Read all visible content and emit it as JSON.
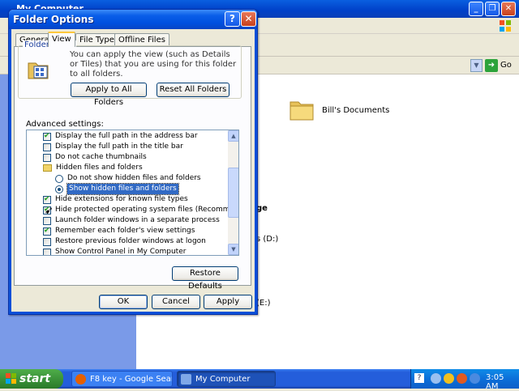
{
  "background_window": {
    "title": "My Computer",
    "address_go_label": "Go",
    "items": [
      {
        "label": "Bill's Documents"
      }
    ],
    "fragments": [
      "ge",
      "s (D:)",
      "(E:)"
    ]
  },
  "dialog": {
    "title": "Folder Options",
    "help_glyph": "?",
    "close_glyph": "✕",
    "tabs": [
      {
        "label": "General"
      },
      {
        "label": "View"
      },
      {
        "label": "File Types"
      },
      {
        "label": "Offline Files"
      }
    ],
    "active_tab": "View",
    "folder_views": {
      "legend": "Folder views",
      "description": "You can apply the view (such as Details or Tiles) that you are using for this folder to all folders.",
      "apply_button": "Apply to All Folders",
      "reset_button": "Reset All Folders"
    },
    "advanced": {
      "label": "Advanced settings:",
      "items": [
        {
          "type": "checkbox",
          "checked": true,
          "label": "Display the full path in the address bar"
        },
        {
          "type": "checkbox",
          "checked": false,
          "label": "Display the full path in the title bar"
        },
        {
          "type": "checkbox",
          "checked": false,
          "label": "Do not cache thumbnails"
        },
        {
          "type": "folder",
          "label": "Hidden files and folders"
        },
        {
          "type": "radio",
          "selected": false,
          "label": "Do not show hidden files and folders"
        },
        {
          "type": "radio",
          "selected": true,
          "label": "Show hidden files and folders"
        },
        {
          "type": "checkbox",
          "checked": true,
          "label": "Hide extensions for known file types"
        },
        {
          "type": "checkbox",
          "checked": true,
          "label": "Hide protected operating system files (Recommended)"
        },
        {
          "type": "checkbox",
          "checked": false,
          "label": "Launch folder windows in a separate process"
        },
        {
          "type": "checkbox",
          "checked": true,
          "label": "Remember each folder's view settings"
        },
        {
          "type": "checkbox",
          "checked": false,
          "label": "Restore previous folder windows at logon"
        },
        {
          "type": "checkbox",
          "checked": false,
          "label": "Show Control Panel in My Computer"
        }
      ],
      "restore_defaults": "Restore Defaults"
    },
    "buttons": {
      "ok": "OK",
      "cancel": "Cancel",
      "apply": "Apply"
    }
  },
  "taskbar": {
    "start_label": "start",
    "tasks": [
      {
        "label": "F8 key - Google Sear..."
      },
      {
        "label": "My Computer"
      }
    ],
    "tray_help": "?",
    "clock": "3:05 AM"
  }
}
